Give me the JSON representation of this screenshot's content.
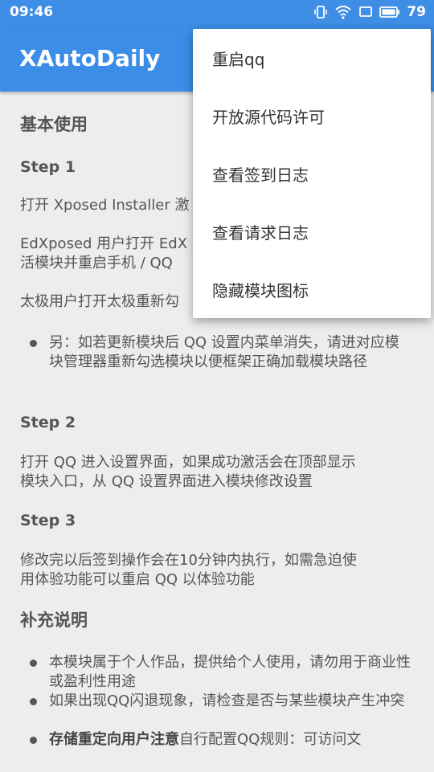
{
  "status_bar": {
    "time": "09:46",
    "battery": "79"
  },
  "app_bar": {
    "title": "XAutoDaily"
  },
  "content": {
    "basic_heading": "基本使用",
    "step1": {
      "label": "Step 1",
      "line1": "打开 Xposed Installer 激",
      "line2a": "EdXposed 用户打开 EdX",
      "line2b": "活模块并重启手机 / QQ",
      "line3": "太极用户打开太极重新勾",
      "note": "另：如若更新模块后 QQ 设置内菜单消失，请进对应模块管理器重新勾选模块以便框架正确加载模块路径"
    },
    "step2": {
      "label": "Step 2",
      "text_line1": "打开 QQ 进入设置界面，如果成功激活会在顶部显示",
      "text_line2": "模块入口，从 QQ 设置界面进入模块修改设置"
    },
    "step3": {
      "label": "Step 3",
      "text_line1": "修改完以后签到操作会在10分钟内执行，如需急迫使",
      "text_line2": "用体验功能可以重启 QQ 以体验功能"
    },
    "supplement_heading": "补充说明",
    "bullets": [
      {
        "text": "本模块属于个人作品，提供给个人使用，请勿用于商业性或盈利性用途"
      },
      {
        "text": "如果出现QQ闪退现象，请检查是否与某些模块产生冲突"
      },
      {
        "bold": "存储重定向用户注意",
        "text": "自行配置QQ规则：可访问文"
      }
    ]
  },
  "menu": {
    "items": [
      {
        "label": "重启qq"
      },
      {
        "label": "开放源代码许可"
      },
      {
        "label": "查看签到日志"
      },
      {
        "label": "查看请求日志"
      },
      {
        "label": "隐藏模块图标"
      }
    ]
  }
}
